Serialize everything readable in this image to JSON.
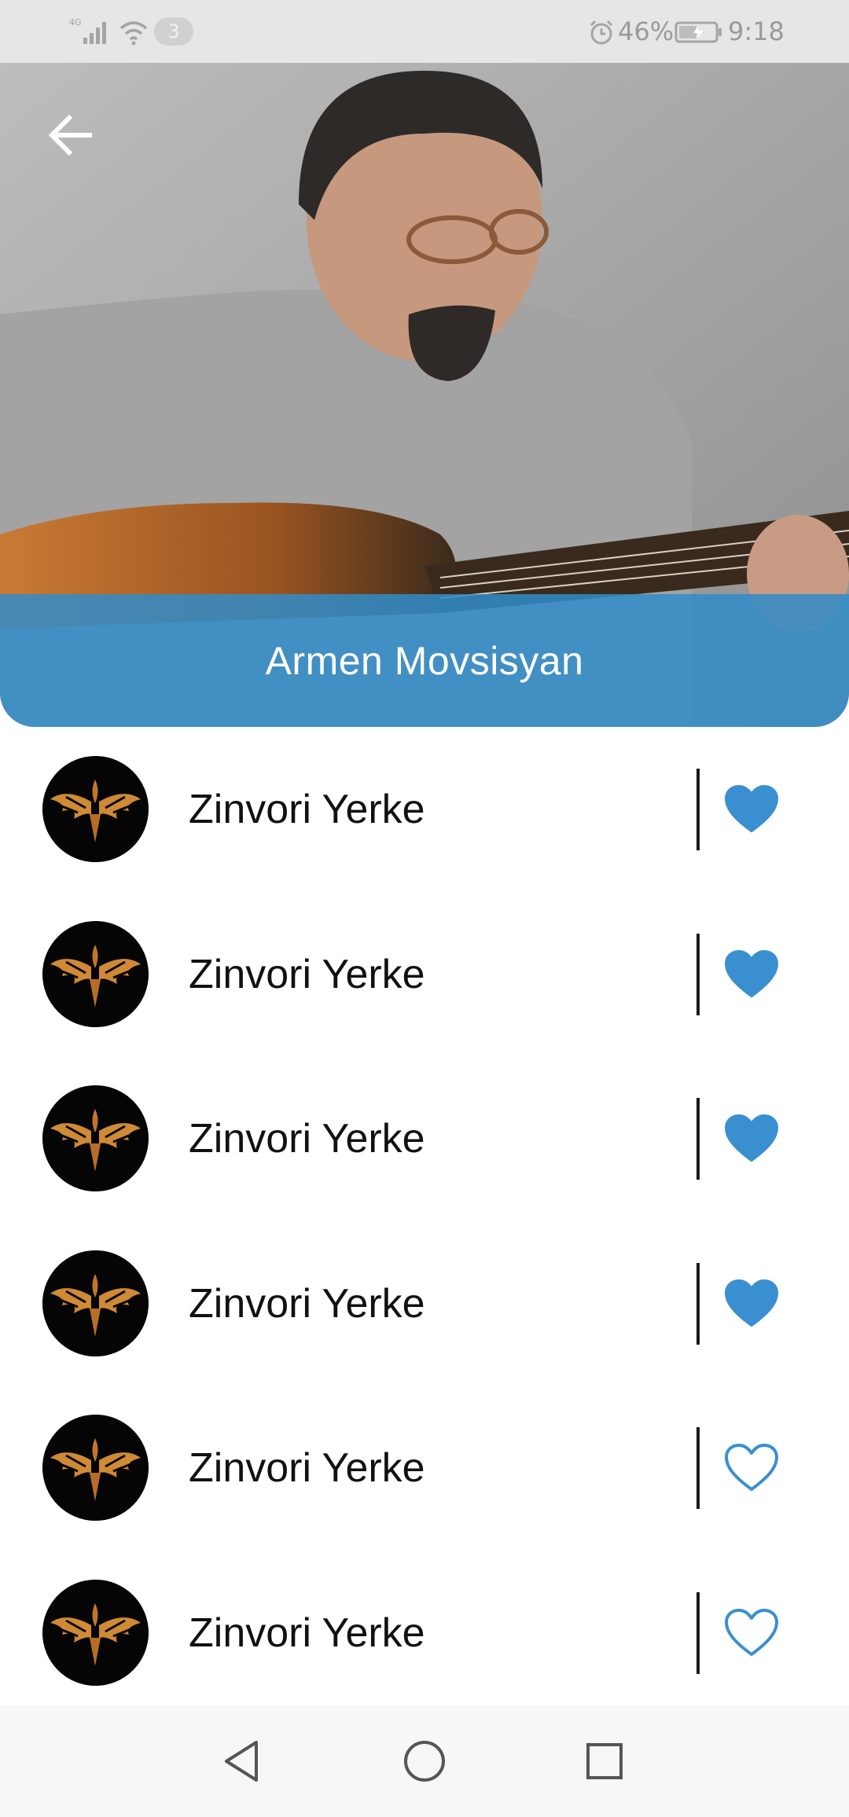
{
  "status_bar": {
    "network": "4G",
    "notification_count": "3",
    "battery": "46%",
    "time": "9:18"
  },
  "header": {
    "artist_name": "Armen Movsisyan",
    "back_icon": "arrow-left-icon",
    "accent_color": "#3a8fd0"
  },
  "songs": [
    {
      "title": "Zinvori Yerke",
      "favorite": true
    },
    {
      "title": "Zinvori Yerke",
      "favorite": true
    },
    {
      "title": "Zinvori Yerke",
      "favorite": true
    },
    {
      "title": "Zinvori Yerke",
      "favorite": true
    },
    {
      "title": "Zinvori Yerke",
      "favorite": false
    },
    {
      "title": "Zinvori Yerke",
      "favorite": false
    }
  ],
  "nav": {
    "back_icon": "triangle-back-icon",
    "home_icon": "circle-home-icon",
    "recent_icon": "square-recents-icon"
  }
}
